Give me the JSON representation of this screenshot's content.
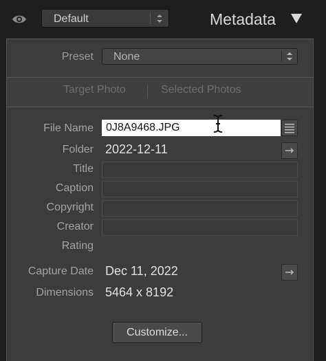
{
  "header": {
    "preset_selector": "Default",
    "title": "Metadata",
    "eye_icon": "eye-icon",
    "collapse_icon": "triangle-down-icon"
  },
  "preset": {
    "label": "Preset",
    "value": "None"
  },
  "tabs": [
    {
      "label": "Target Photo"
    },
    {
      "label": "Selected Photos"
    }
  ],
  "fields": {
    "file_name": {
      "label": "File Name",
      "value": "0J8A9468.JPG"
    },
    "folder": {
      "label": "Folder",
      "value": "2022-12-11"
    },
    "title": {
      "label": "Title",
      "value": ""
    },
    "caption": {
      "label": "Caption",
      "value": ""
    },
    "copyright": {
      "label": "Copyright",
      "value": ""
    },
    "creator": {
      "label": "Creator",
      "value": ""
    },
    "rating": {
      "label": "Rating",
      "value": ""
    },
    "capture_date": {
      "label": "Capture Date",
      "value": "Dec 11, 2022"
    },
    "dimensions": {
      "label": "Dimensions",
      "value": "5464 x 8192"
    }
  },
  "customize_button": "Customize...",
  "colors": {
    "background": "#1e1e1e",
    "panel": "#3c3c3c",
    "text": "#e2e2e2",
    "label": "#a3a3a3"
  }
}
